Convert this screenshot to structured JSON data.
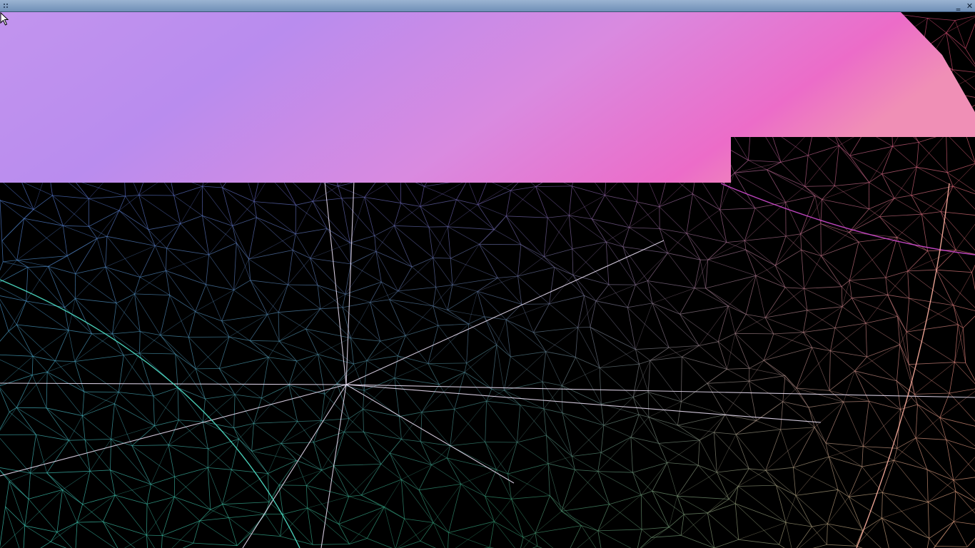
{
  "window": {
    "titlebar": {
      "minimize_glyph": "‗",
      "close_glyph": "✕",
      "grip_icon": "grip-dots-icon"
    }
  },
  "scene": {
    "kind": "3d-wireframe-render",
    "overlay_colors": [
      "#c294ee",
      "#b98cee",
      "#d98ae0",
      "#ec6cc8",
      "#f08fb6"
    ],
    "mesh_palette": [
      "#5b49d9",
      "#8b3cc4",
      "#c13ca0",
      "#d84b6c",
      "#3fc9b6",
      "#2f8e6a",
      "#e8a080",
      "#ffffff"
    ],
    "cursor_icon": "mouse-pointer-icon"
  }
}
